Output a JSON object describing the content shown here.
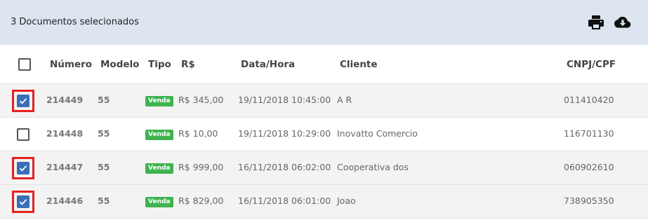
{
  "selection": {
    "count_text": "3 Documentos selecionados",
    "actions": [
      {
        "icon": "print-icon",
        "name": "print-button"
      },
      {
        "icon": "cloud-download-icon",
        "name": "download-button"
      }
    ]
  },
  "table": {
    "headers": {
      "numero": "Número",
      "modelo": "Modelo",
      "tipo": "Tipo",
      "valor": "R$",
      "data": "Data/Hora",
      "cliente": "Cliente",
      "cnpj": "CNPJ/CPF"
    },
    "rows": [
      {
        "checked": true,
        "numero": "214449",
        "modelo": "55",
        "tipo": "Venda",
        "valor": "R$ 345,00",
        "data": "19/11/2018 10:45:00",
        "cliente": "A R",
        "cnpj": "011410420"
      },
      {
        "checked": false,
        "numero": "214448",
        "modelo": "55",
        "tipo": "Venda",
        "valor": "R$ 10,00",
        "data": "19/11/2018 10:29:00",
        "cliente": "Inovatto Comercio",
        "cnpj": "116701130"
      },
      {
        "checked": true,
        "numero": "214447",
        "modelo": "55",
        "tipo": "Venda",
        "valor": "R$ 999,00",
        "data": "16/11/2018 06:02:00",
        "cliente": "Cooperativa dos",
        "cnpj": "060902610"
      },
      {
        "checked": true,
        "numero": "214446",
        "modelo": "55",
        "tipo": "Venda",
        "valor": "R$ 829,00",
        "data": "16/11/2018 06:01:00",
        "cliente": "Joao",
        "cnpj": "738905350"
      }
    ]
  },
  "colors": {
    "selection_bar": "#dce5f0",
    "checkbox_checked": "#3a6fb7",
    "badge_green": "#3fb34f",
    "highlight_red": "#e52121"
  }
}
